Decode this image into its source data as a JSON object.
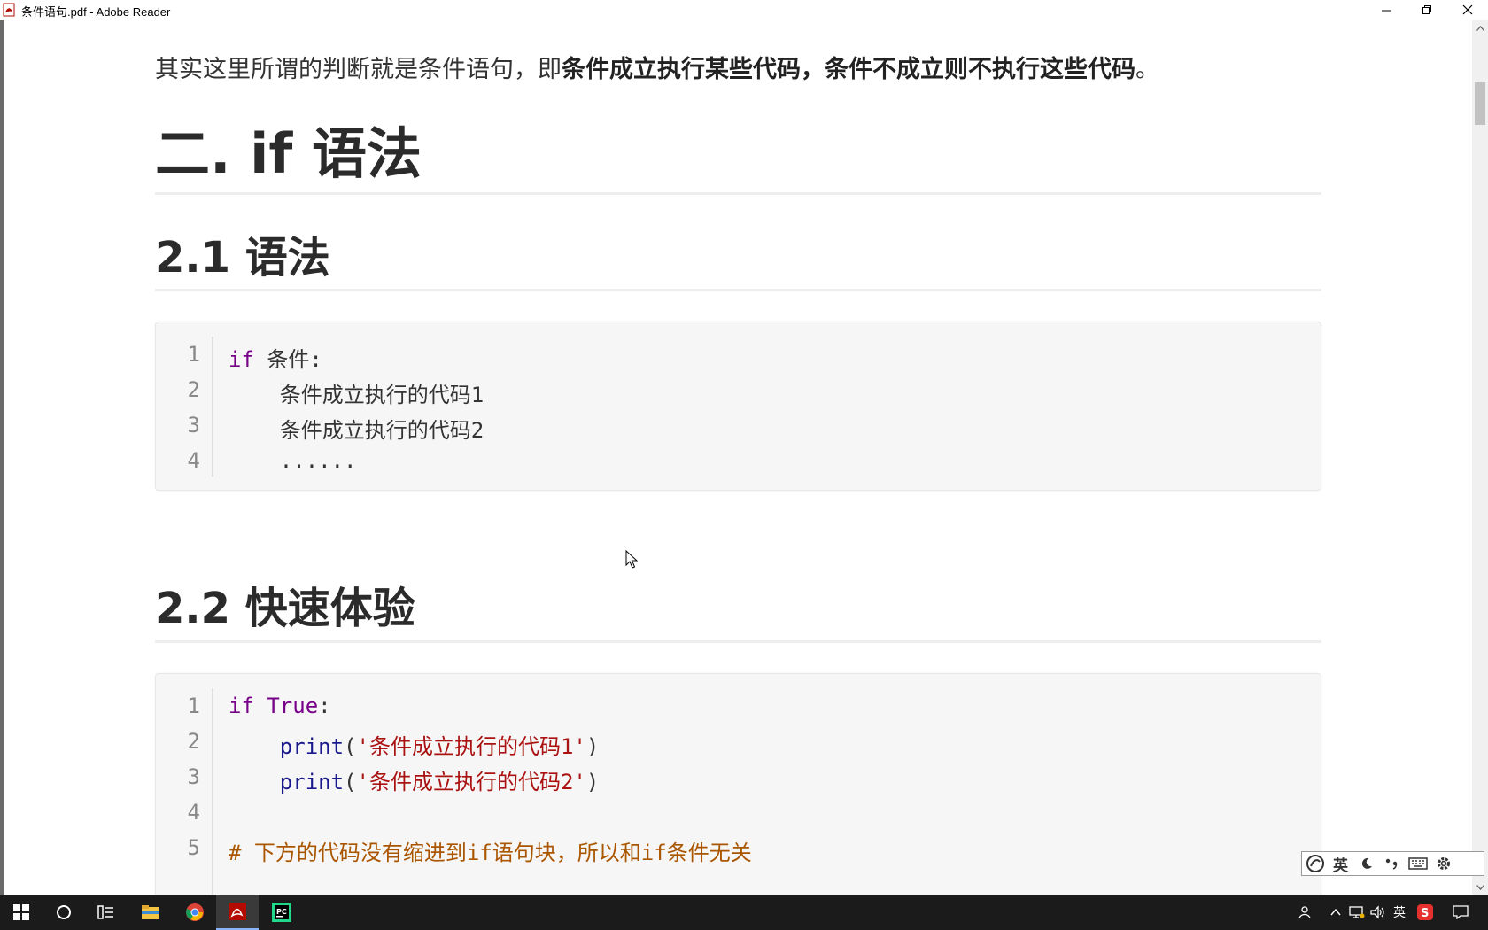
{
  "window": {
    "title": "条件语句.pdf - Adobe Reader",
    "minimize_icon": "minimize-icon",
    "restore_icon": "restore-icon",
    "close_icon": "close-icon"
  },
  "document": {
    "intro_plain": "其实这里所谓的判断就是条件语句，即",
    "intro_bold": "条件成立执行某些代码，条件不成立则不执行这些代码",
    "intro_end": "。",
    "heading_2": "二. if 语法",
    "heading_2_1": "2.1 语法",
    "heading_2_2": "2.2 快速体验",
    "code1": {
      "line_numbers": [
        "1",
        "2",
        "3",
        "4"
      ],
      "l1_kw": "if",
      "l1_rest": " 条件:",
      "l2": "    条件成立执行的代码1",
      "l3": "    条件成立执行的代码2",
      "l4": "    ......"
    },
    "code2": {
      "line_numbers": [
        "1",
        "2",
        "3",
        "4",
        "5"
      ],
      "l1_kw": "if",
      "l1_val": " True",
      "l1_end": ":",
      "l2_indent": "    ",
      "l2_fn": "print",
      "l2_open": "(",
      "l2_str": "'条件成立执行的代码1'",
      "l2_close": ")",
      "l3_indent": "    ",
      "l3_fn": "print",
      "l3_open": "(",
      "l3_str": "'条件成立执行的代码2'",
      "l3_close": ")",
      "l5_comment": "# 下方的代码没有缩进到if语句块，所以和if条件无关"
    }
  },
  "ime": {
    "items": [
      "sogou-logo-icon",
      "英",
      "moon-icon",
      "punctuation-icon",
      "keyboard-icon",
      "gear-icon"
    ],
    "lang": "英"
  },
  "taskbar": {
    "apps": [
      "windows-start-icon",
      "cortana-search-icon",
      "task-view-icon",
      "file-explorer-icon",
      "chrome-icon",
      "adobe-reader-icon",
      "pycharm-icon"
    ],
    "tray_lang": "英"
  },
  "colors": {
    "keyword": "#770088",
    "function": "#1a1a8e",
    "string": "#aa1111",
    "comment": "#aa5500"
  }
}
